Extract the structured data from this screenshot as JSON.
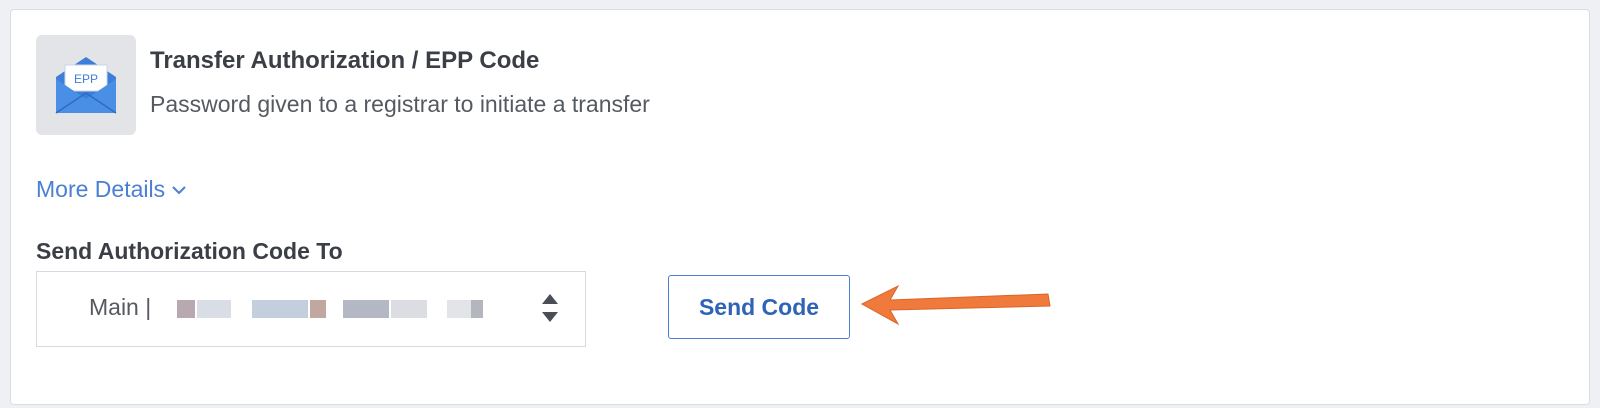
{
  "header": {
    "icon_label": "EPP",
    "title": "Transfer Authorization / EPP Code",
    "subtitle": "Password given to a registrar to initiate a transfer"
  },
  "more_details": {
    "label": "More Details"
  },
  "auth_code": {
    "field_label": "Send Authorization Code To",
    "selected_value": "Main |",
    "send_button_label": "Send Code"
  },
  "colors": {
    "accent_blue": "#4a7fd4",
    "annotation_arrow": "#f07a3c",
    "envelope_blue": "#3d7ed8"
  }
}
